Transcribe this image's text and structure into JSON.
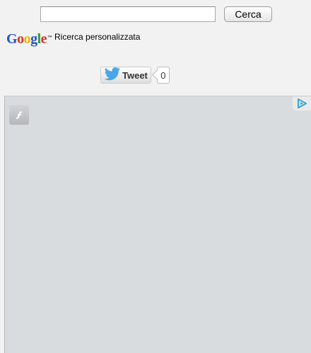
{
  "search": {
    "value": "",
    "button_label": "Cerca"
  },
  "branding": {
    "logo_letters": [
      "G",
      "o",
      "o",
      "g",
      "l",
      "e"
    ],
    "trademark": "™",
    "text": "Ricerca personalizzata"
  },
  "tweet": {
    "label": "Tweet",
    "count": "0",
    "icon": "twitter-bird-icon"
  },
  "ad": {
    "icons": [
      "flash-plugin-icon",
      "adchoices-icon"
    ]
  },
  "colors": {
    "background": "#f2f2f2",
    "ad_background": "#d9dcdf",
    "twitter_blue": "#4aa6e6",
    "adchoices_blue": "#3fa3d8"
  }
}
